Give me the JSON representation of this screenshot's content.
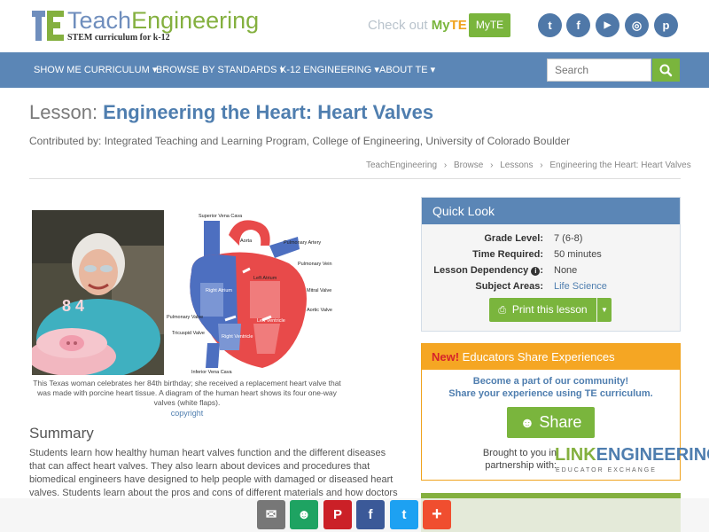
{
  "header": {
    "logo_part1": "Teach",
    "logo_part2": "Engineering",
    "logo_tagline": "STEM curriculum for k-12",
    "checkout_text": "Check out ",
    "checkout_my": "My",
    "checkout_te": "TE",
    "myte_button": "MyTE",
    "social": [
      {
        "name": "twitter",
        "glyph": "t"
      },
      {
        "name": "facebook",
        "glyph": "f"
      },
      {
        "name": "youtube",
        "glyph": "▶"
      },
      {
        "name": "instagram",
        "glyph": "◎"
      },
      {
        "name": "pinterest",
        "glyph": "p"
      }
    ]
  },
  "nav": {
    "items": [
      "SHOW ME CURRICULUM",
      "BROWSE BY STANDARDS",
      "K-12 ENGINEERING",
      "ABOUT TE"
    ],
    "caret": "▾",
    "search_placeholder": "Search"
  },
  "page": {
    "title_prefix": "Lesson: ",
    "title": "Engineering the Heart: Heart Valves",
    "contributed": "Contributed by: Integrated Teaching and Learning Program, College of Engineering, University of Colorado Boulder",
    "breadcrumb": [
      "TeachEngineering",
      "Browse",
      "Lessons",
      "Engineering the Heart: Heart Valves"
    ],
    "breadcrumb_sep": "›"
  },
  "figure": {
    "cake_label": "8 4",
    "heart_labels": [
      "Superior Vena Cava",
      "Aorta",
      "Pulmonary Artery",
      "Pulmonary Vein",
      "Left Atrium",
      "Right Atrium",
      "Mitral Valve",
      "Aortic Valve",
      "Pulmonary Valve",
      "Tricuspid Valve",
      "Left Ventricle",
      "Right Ventricle",
      "Inferior Vena Cava"
    ],
    "caption": "This Texas woman celebrates her 84th birthday; she received a replacement heart valve that was made with porcine heart tissue. A diagram of the human heart shows its four one-way valves (white flaps).",
    "copyright": "copyright"
  },
  "summary": {
    "heading": "Summary",
    "text": "Students learn how healthy human heart valves function and the different diseases that can affect heart valves. They also learn about devices and procedures that biomedical engineers have designed to help people with damaged or diseased heart valves. Students learn about the pros and cons of different materials and how doctors choose"
  },
  "quick_look": {
    "title": "Quick Look",
    "rows": [
      {
        "k": "Grade Level:",
        "v": "7 (6-8)"
      },
      {
        "k": "Time Required:",
        "v": "50 minutes"
      },
      {
        "k": "Lesson Dependency",
        "v": "None"
      },
      {
        "k": "Subject Areas:",
        "v": "Life Science"
      }
    ],
    "info_icon": "i",
    "print_label": "Print this lesson"
  },
  "educators": {
    "new": "New!",
    "title": " Educators Share Experiences",
    "line1": "Become a part of our community!",
    "line2": "Share your experience using TE curriculum.",
    "share_label": "Share",
    "brought_by": "Brought to you in partnership with:",
    "le_link": "LINK",
    "le_engineering": "ENGINEERING",
    "le_sub": "EDUCATOR EXCHANGE"
  },
  "share_bar": [
    {
      "name": "email",
      "glyph": "✉",
      "color": "#777777"
    },
    {
      "name": "community",
      "glyph": "☻",
      "color": "#1ea362"
    },
    {
      "name": "pinterest",
      "glyph": "P",
      "color": "#cb2027"
    },
    {
      "name": "facebook",
      "glyph": "f",
      "color": "#3b5998"
    },
    {
      "name": "twitter",
      "glyph": "t",
      "color": "#1da1f2"
    },
    {
      "name": "more",
      "glyph": "+",
      "color": "#f04e2f"
    }
  ],
  "colors": {
    "brand_blue": "#5b86b6",
    "brand_green": "#7ab53d",
    "orange": "#f5a623"
  }
}
